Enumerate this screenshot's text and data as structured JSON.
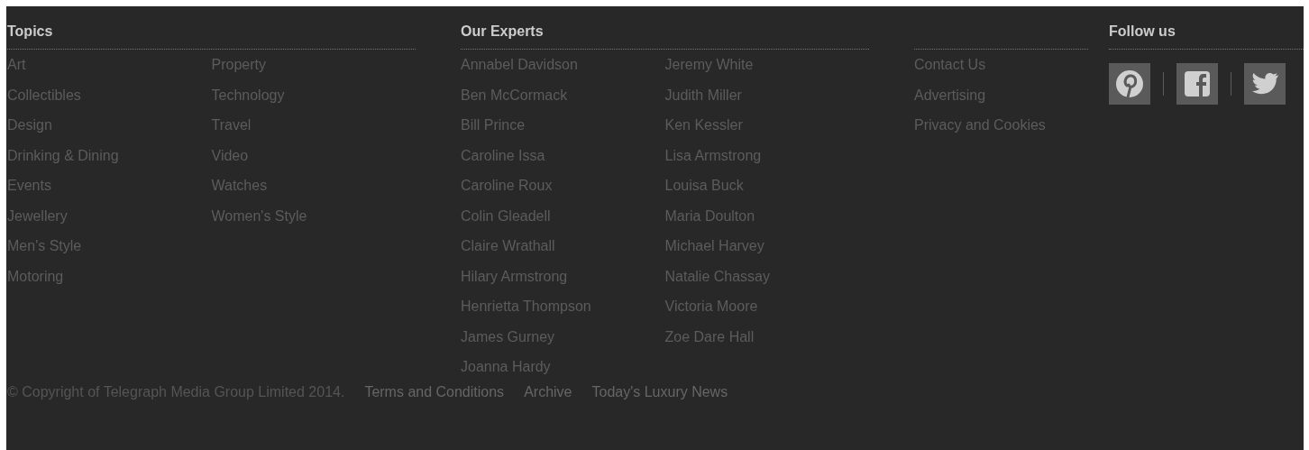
{
  "columns": [
    {
      "heading": "Topics",
      "subcolumns": [
        [
          "Art",
          "Collectibles",
          "Design",
          "Drinking & Dining",
          "Events",
          "Jewellery",
          "Men's Style",
          "Motoring"
        ],
        [
          "Property",
          "Technology",
          "Travel",
          "Video",
          "Watches",
          "Women's Style"
        ]
      ]
    },
    {
      "heading": "Our Experts",
      "subcolumns": [
        [
          "Annabel Davidson",
          "Ben McCormack",
          "Bill Prince",
          "Caroline Issa",
          "Caroline Roux",
          "Colin Gleadell",
          "Claire Wrathall",
          "Hilary Armstrong",
          "Henrietta Thompson",
          "James Gurney",
          "Joanna Hardy"
        ],
        [
          "Jeremy White",
          "Judith Miller",
          "Ken Kessler",
          "Lisa Armstrong",
          "Louisa Buck",
          "Maria Doulton",
          "Michael Harvey",
          "Natalie Chassay",
          "Victoria Moore",
          "Zoe Dare Hall"
        ]
      ]
    }
  ],
  "info_links": [
    "Contact Us",
    "Advertising",
    "Privacy and Cookies"
  ],
  "follow": {
    "heading": "Follow us",
    "networks": [
      {
        "kind": "pinterest"
      },
      {
        "kind": "facebook"
      },
      {
        "kind": "twitter"
      }
    ]
  },
  "footer": {
    "copyright": "© Copyright of Telegraph Media Group Limited 2014.",
    "links": [
      "Terms and Conditions",
      "Archive",
      "Today's Luxury News"
    ]
  }
}
